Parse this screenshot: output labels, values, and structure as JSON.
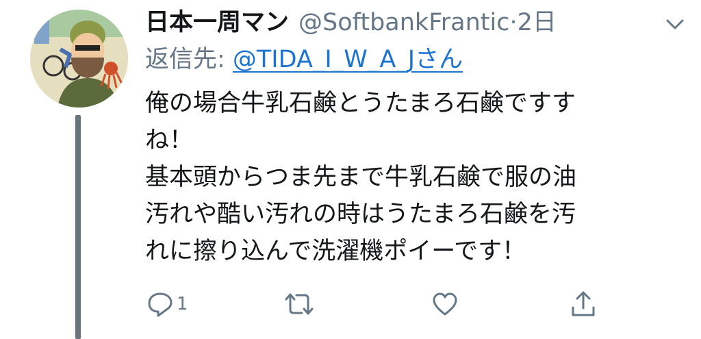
{
  "tweet": {
    "author_name": "日本一周マン",
    "handle": "@SoftbankFrantic",
    "separator": "·",
    "time": "2日",
    "reply_prefix": "返信先: ",
    "reply_mention": "@TIDA_I_W_A_Jさん",
    "body_lines": [
      "俺の場合牛乳石鹸とうたまろ石鹸ですす",
      "ね！",
      "基本頭からつま先まで牛乳石鹸で服の油",
      "汚れや酷い汚れの時はうたまろ石鹸を汚",
      "れに擦り込んで洗濯機ポイーです！"
    ]
  },
  "actions": {
    "reply_count": "1",
    "retweet_count": "",
    "like_count": ""
  },
  "icons": {
    "menu": "chevron-down-icon",
    "reply": "reply-icon",
    "retweet": "retweet-icon",
    "like": "heart-icon",
    "share": "share-icon"
  },
  "colors": {
    "text": "#14171a",
    "secondary": "#657786",
    "link": "#1b74d0",
    "thread_line": "#69737c"
  }
}
